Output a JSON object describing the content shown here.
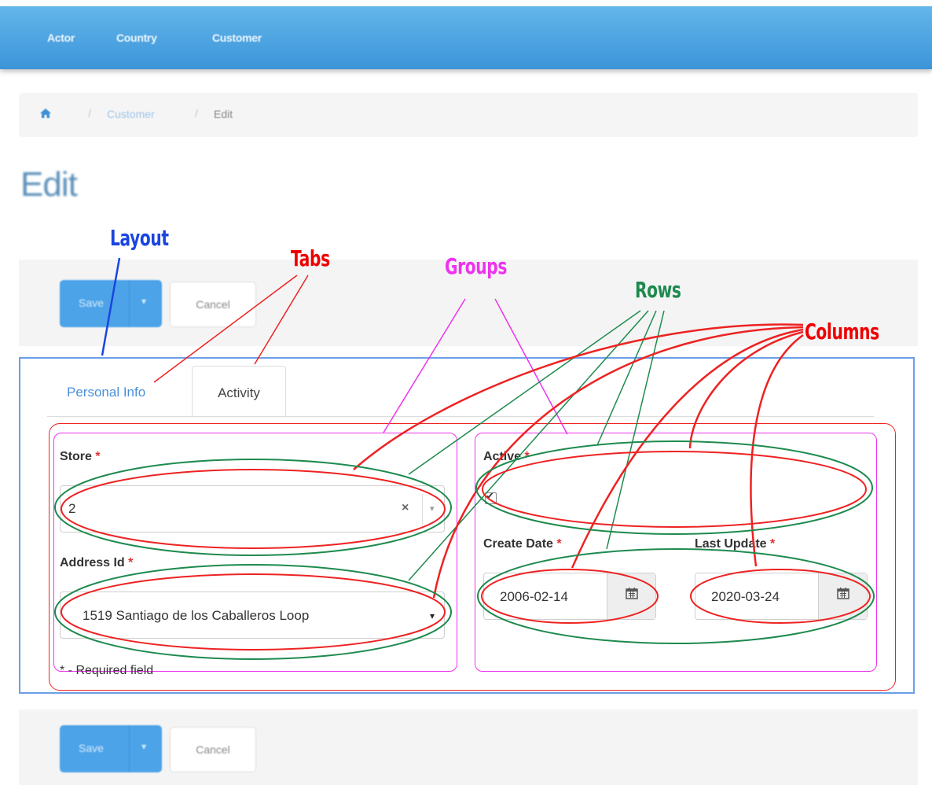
{
  "navbar": {
    "items": [
      {
        "label": "Actor"
      },
      {
        "label": "Country"
      },
      {
        "label": "Customer"
      }
    ]
  },
  "breadcrumb": {
    "home_icon": "home-icon",
    "separator": "/",
    "items": [
      {
        "label": "Customer"
      },
      {
        "label": "Edit"
      }
    ]
  },
  "page": {
    "title": "Edit"
  },
  "toolbar": {
    "save_label": "Save",
    "caret": "▾",
    "cancel_label": "Cancel"
  },
  "tabs": [
    {
      "label": "Personal Info",
      "active": false
    },
    {
      "label": "Activity",
      "active": true
    }
  ],
  "form": {
    "store": {
      "label": "Store",
      "required": "*",
      "value": "2",
      "clear": "×",
      "arrow": "▾"
    },
    "address": {
      "label": "Address Id",
      "required": "*",
      "value": "1519 Santiago de los Caballeros Loop",
      "arrow": "▾"
    },
    "active": {
      "label": "Active",
      "required": "*",
      "checked": true,
      "check_glyph": "✔"
    },
    "create_date": {
      "label": "Create Date",
      "required": "*",
      "value": "2006-02-14",
      "icon": "calendar-icon"
    },
    "last_update": {
      "label": "Last Update",
      "required": "*",
      "value": "2020-03-24",
      "icon": "calendar-icon"
    },
    "required_note": "* - Required field"
  },
  "annotations": {
    "layout": "Layout",
    "tabs": "Tabs",
    "groups": "Groups",
    "rows": "Rows",
    "columns": "Columns"
  },
  "colors": {
    "navbar": "#3d95d9",
    "primary": "#4da3e8",
    "layout_box": "#6b9fe8",
    "tabs_annotation": "#ee0000",
    "groups_annotation": "#ee33ee",
    "rows_annotation": "#1e8a4e",
    "columns_annotation": "#ee2222"
  }
}
